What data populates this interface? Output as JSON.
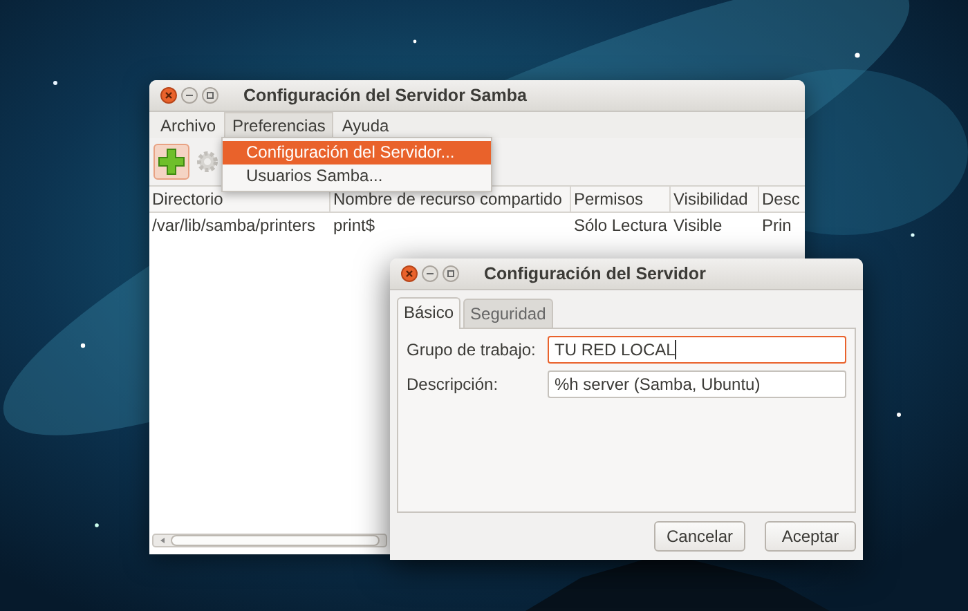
{
  "main_window": {
    "title": "Configuración del Servidor Samba",
    "menu": [
      {
        "label": "Archivo",
        "selected": false
      },
      {
        "label": "Preferencias",
        "selected": true
      },
      {
        "label": "Ayuda",
        "selected": false
      }
    ],
    "dropdown": [
      {
        "label": "Configuración del Servidor...",
        "selected": true
      },
      {
        "label": "Usuarios Samba...",
        "selected": false
      }
    ],
    "toolbar": [
      {
        "kind": "add",
        "highlighted": true,
        "disabled": false
      },
      {
        "kind": "settings",
        "highlighted": false,
        "disabled": true
      }
    ],
    "table": {
      "columns": [
        "Directorio",
        "Nombre de recurso compartido",
        "Permisos",
        "Visibilidad",
        "Desc"
      ],
      "rows": [
        [
          "/var/lib/samba/printers",
          "print$",
          "Sólo Lectura",
          "Visible",
          "Prin"
        ]
      ]
    }
  },
  "dialog": {
    "title": "Configuración del Servidor",
    "tabs": [
      {
        "label": "Básico",
        "selected": true
      },
      {
        "label": "Seguridad",
        "selected": false
      }
    ],
    "fields": [
      {
        "label": "Grupo de trabajo:",
        "value": "TU RED LOCAL",
        "focused": true
      },
      {
        "label": "Descripción:",
        "value": "%h server (Samba, Ubuntu)",
        "focused": false
      }
    ],
    "buttons": [
      "Cancelar",
      "Aceptar"
    ]
  }
}
